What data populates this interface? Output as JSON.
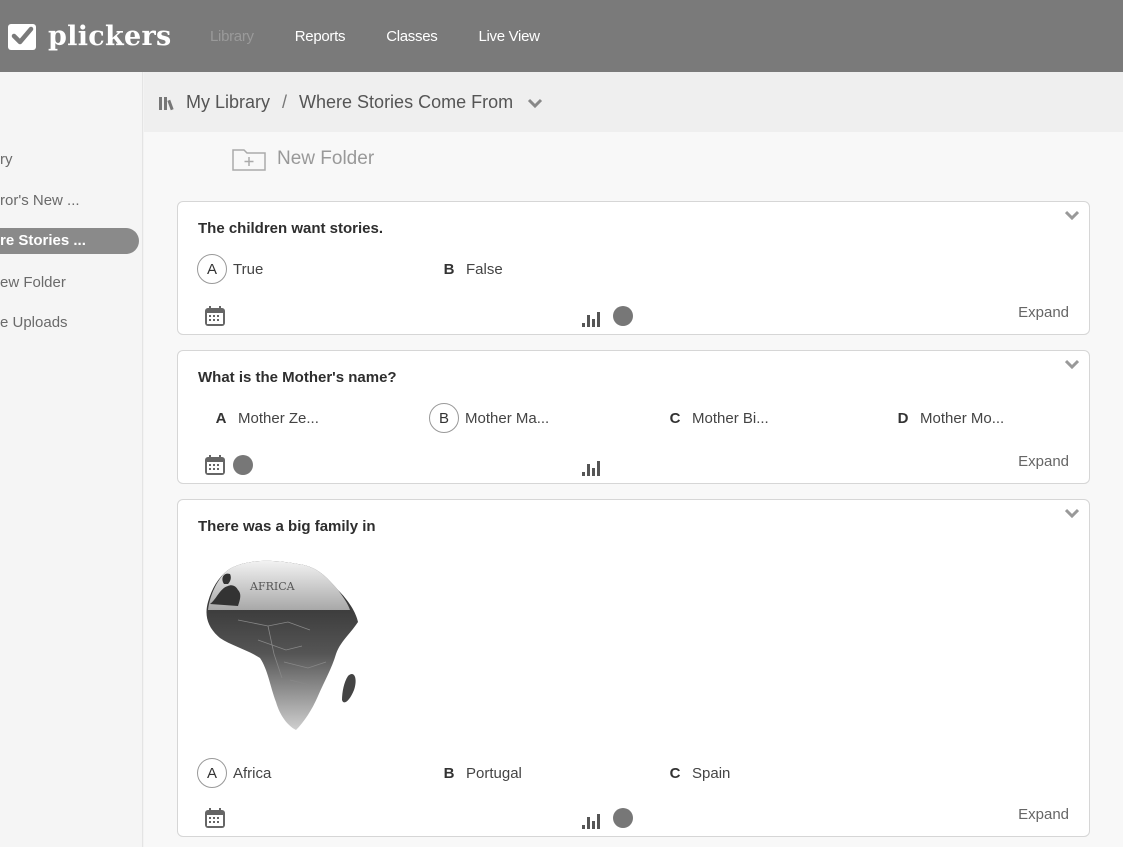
{
  "app": {
    "brand": "plickers"
  },
  "nav": [
    {
      "label": "Library",
      "active": true
    },
    {
      "label": "Reports",
      "active": false
    },
    {
      "label": "Classes",
      "active": false
    },
    {
      "label": "Live View",
      "active": false
    }
  ],
  "sidebar": {
    "items": [
      {
        "label": "ry"
      },
      {
        "label": "ror's New ..."
      },
      {
        "label": "re Stories ...",
        "active": true
      },
      {
        "label": "ew Folder"
      },
      {
        "label": "e Uploads"
      }
    ]
  },
  "breadcrumb": {
    "root": "My Library",
    "separator": "/",
    "current": "Where Stories Come From"
  },
  "toolbar": {
    "new_folder": "New Folder"
  },
  "questions": [
    {
      "text": "The children want stories.",
      "choices": [
        {
          "letter": "A",
          "text": "True",
          "correct": true
        },
        {
          "letter": "B",
          "text": "False",
          "correct": false
        }
      ],
      "expand": "Expand"
    },
    {
      "text": "What is the Mother's name?",
      "choices": [
        {
          "letter": "A",
          "text": "Mother Ze...",
          "correct": false
        },
        {
          "letter": "B",
          "text": "Mother Ma...",
          "correct": true
        },
        {
          "letter": "C",
          "text": "Mother Bi...",
          "correct": false
        },
        {
          "letter": "D",
          "text": "Mother Mo...",
          "correct": false
        }
      ],
      "expand": "Expand"
    },
    {
      "text": "There was a big family in",
      "image_label": "AFRICA",
      "choices": [
        {
          "letter": "A",
          "text": "Africa",
          "correct": true
        },
        {
          "letter": "B",
          "text": "Portugal",
          "correct": false
        },
        {
          "letter": "C",
          "text": "Spain",
          "correct": false
        }
      ],
      "expand": "Expand"
    }
  ],
  "colors": {
    "topbar": "#7a7a7a",
    "status_dot": "#777777",
    "sidebar_active": "#8a8a8a"
  }
}
